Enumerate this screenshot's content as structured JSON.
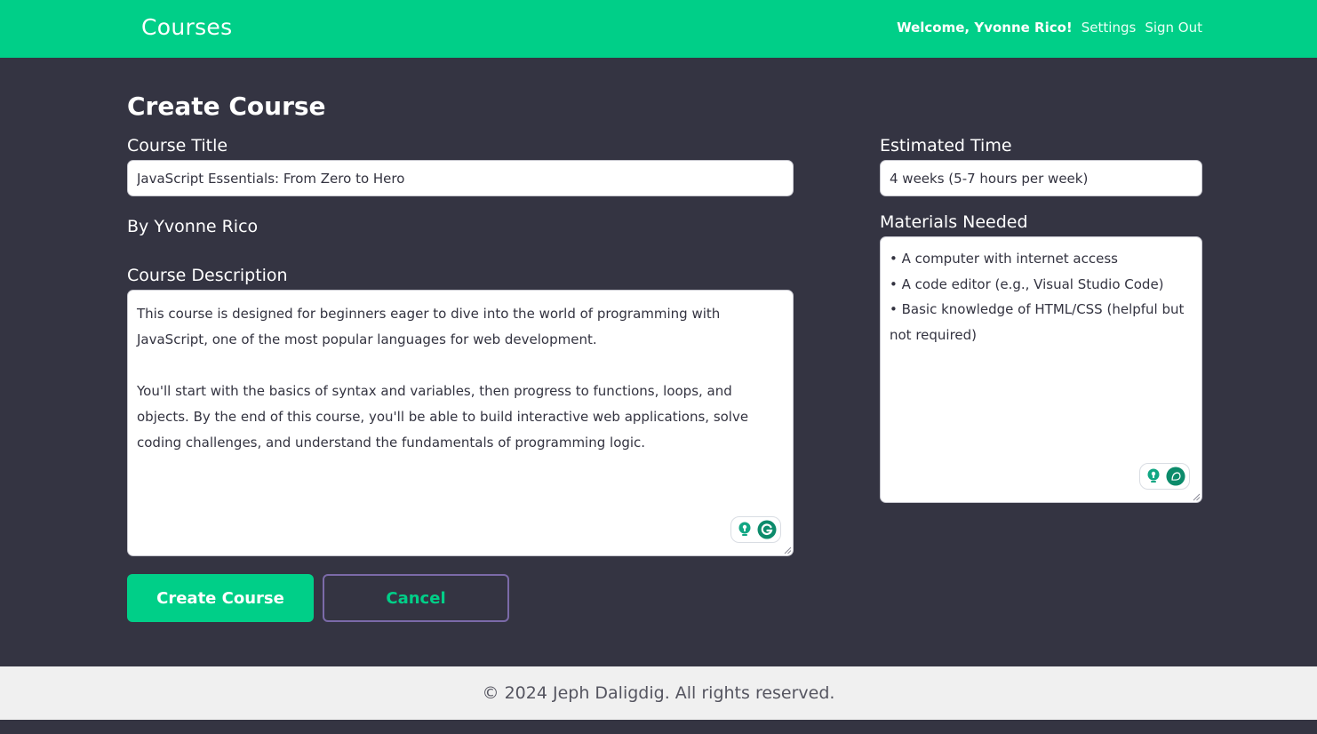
{
  "header": {
    "brand": "Courses",
    "welcome": "Welcome, Yvonne Rico!",
    "settings": "Settings",
    "sign_out": "Sign Out"
  },
  "page": {
    "title": "Create Course"
  },
  "form": {
    "course_title_label": "Course Title",
    "course_title_value": "JavaScript Essentials: From Zero to Hero",
    "author": "By Yvonne Rico",
    "description_label": "Course Description",
    "description_value": "This course is designed for beginners eager to dive into the world of programming with JavaScript, one of the most popular languages for web development.\n\nYou'll start with the basics of syntax and variables, then progress to functions, loops, and objects. By the end of this course, you'll be able to build interactive web applications, solve coding challenges, and understand the fundamentals of programming logic.",
    "estimated_time_label": "Estimated Time",
    "estimated_time_value": "4 weeks (5-7 hours per week)",
    "materials_label": "Materials Needed",
    "materials_value": "• A computer with internet access\n• A code editor (e.g., Visual Studio Code)\n• Basic knowledge of HTML/CSS (helpful but not required)"
  },
  "buttons": {
    "create": "Create Course",
    "cancel": "Cancel"
  },
  "footer": {
    "copyright": "© 2024 Jeph Daligdig. All rights reserved."
  },
  "colors": {
    "accent": "#00cf88",
    "background": "#343442",
    "footer_bg": "#f0f0f0",
    "cancel_border": "#7b6aa8"
  },
  "icons": {
    "grammarly_bulb": "lightbulb-icon",
    "grammarly_logo": "grammarly-icon",
    "grammarly_chat": "chat-bubble-icon"
  }
}
